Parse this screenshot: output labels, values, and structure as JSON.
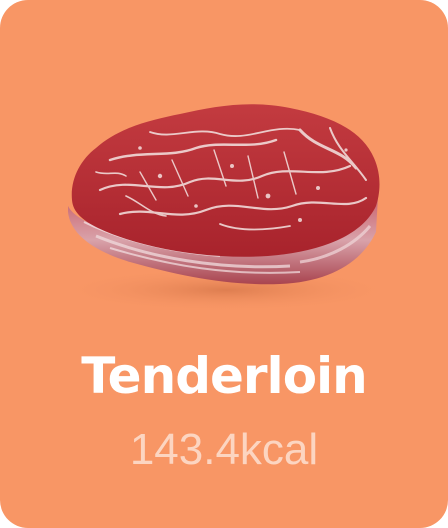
{
  "card": {
    "title": "Tenderloin",
    "calories": "143.4kcal",
    "image_subject": "raw-tenderloin-steak",
    "colors": {
      "background": "#F89665",
      "title": "#FFFFFF",
      "calories": "#FFFFFF99",
      "meat": "#B42D33"
    }
  }
}
